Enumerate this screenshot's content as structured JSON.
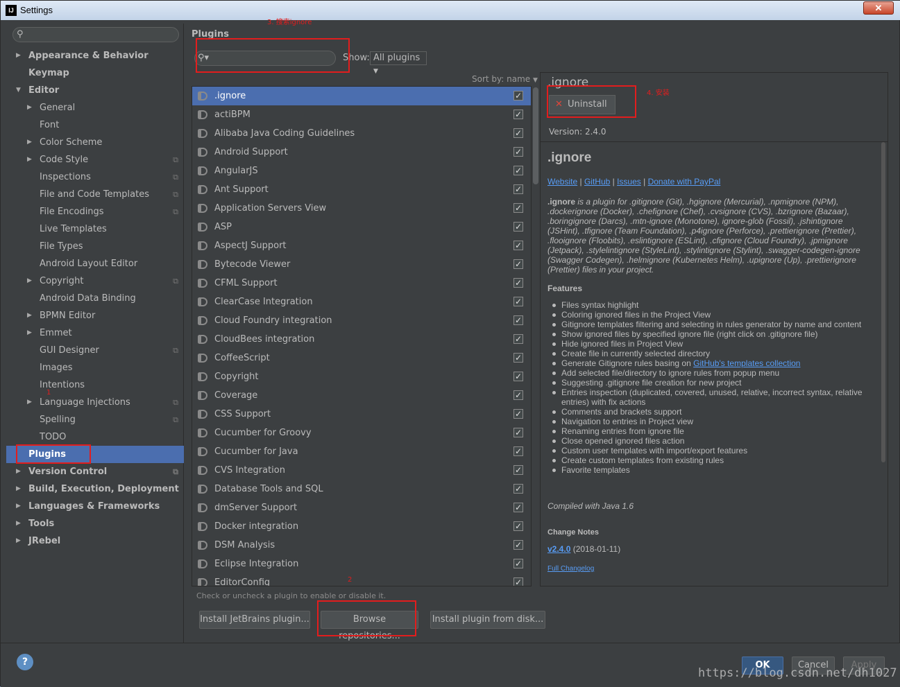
{
  "window": {
    "title": "Settings",
    "app_icon": "IJ",
    "close": "✕"
  },
  "sidebar": {
    "search_placeholder": "",
    "items": [
      {
        "label": "Appearance & Behavior"
      },
      {
        "label": "Keymap"
      },
      {
        "label": "Editor"
      },
      {
        "label": "General"
      },
      {
        "label": "Font"
      },
      {
        "label": "Color Scheme"
      },
      {
        "label": "Code Style"
      },
      {
        "label": "Inspections"
      },
      {
        "label": "File and Code Templates"
      },
      {
        "label": "File Encodings"
      },
      {
        "label": "Live Templates"
      },
      {
        "label": "File Types"
      },
      {
        "label": "Android Layout Editor"
      },
      {
        "label": "Copyright"
      },
      {
        "label": "Android Data Binding"
      },
      {
        "label": "BPMN Editor"
      },
      {
        "label": "Emmet"
      },
      {
        "label": "GUI Designer"
      },
      {
        "label": "Images"
      },
      {
        "label": "Intentions"
      },
      {
        "label": "Language Injections"
      },
      {
        "label": "Spelling"
      },
      {
        "label": "TODO"
      },
      {
        "label": "Plugins"
      },
      {
        "label": "Version Control"
      },
      {
        "label": "Build, Execution, Deployment"
      },
      {
        "label": "Languages & Frameworks"
      },
      {
        "label": "Tools"
      },
      {
        "label": "JRebel"
      }
    ]
  },
  "plugins": {
    "title": "Plugins",
    "search_value": "",
    "show_label": "Show:",
    "show_value": "All plugins",
    "sort_label": "Sort by: name",
    "list": [
      ".ignore",
      "actiBPM",
      "Alibaba Java Coding Guidelines",
      "Android Support",
      "AngularJS",
      "Ant Support",
      "Application Servers View",
      "ASP",
      "AspectJ Support",
      "Bytecode Viewer",
      "CFML Support",
      "ClearCase Integration",
      "Cloud Foundry integration",
      "CloudBees integration",
      "CoffeeScript",
      "Copyright",
      "Coverage",
      "CSS Support",
      "Cucumber for Groovy",
      "Cucumber for Java",
      "CVS Integration",
      "Database Tools and SQL",
      "dmServer Support",
      "Docker integration",
      "DSM Analysis",
      "Eclipse Integration",
      "EditorConfig"
    ],
    "checkmark": "✓",
    "hint": "Check or uncheck a plugin to enable or disable it.",
    "buttons": {
      "install_jetbrains": "Install JetBrains plugin...",
      "browse": "Browse repositories...",
      "install_disk": "Install plugin from disk..."
    }
  },
  "detail": {
    "name": ".ignore",
    "uninstall": "Uninstall",
    "version": "Version: 2.4.0",
    "heading": ".ignore",
    "links": [
      "Website",
      "GitHub",
      "Issues",
      "Donate with PayPal"
    ],
    "intro_name": ".ignore",
    "intro_text": " is a plugin for .gitignore (Git), .hgignore (Mercurial), .npmignore (NPM), .dockerignore (Docker), .chefignore (Chef), .cvsignore (CVS), .bzrignore (Bazaar), .boringignore (Darcs), .mtn-ignore (Monotone), ignore-glob (Fossil), .jshintignore (JSHint), .tfignore (Team Foundation), .p4ignore (Perforce), .prettierignore (Prettier), .flooignore (Floobits), .eslintignore (ESLint), .cfignore (Cloud Foundry), .jpmignore (Jetpack), .stylelintignore (StyleLint), .stylintignore (Stylint), .swagger-codegen-ignore (Swagger Codegen), .helmignore (Kubernetes Helm), .upignore (Up), .prettierignore (Prettier) files in your project.",
    "features_title": "Features",
    "features": [
      "Files syntax highlight",
      "Coloring ignored files in the Project View",
      "Gitignore templates filtering and selecting in rules generator by name and content",
      "Show ignored files by specified ignore file (right click on .gitignore file)",
      "Hide ignored files in Project View",
      "Create file in currently selected directory",
      "Generate Gitignore rules basing on ",
      "Add selected file/directory to ignore rules from popup menu",
      "Suggesting .gitignore file creation for new project",
      "Entries inspection (duplicated, covered, unused, relative, incorrect syntax, relative entries) with fix actions",
      "Comments and brackets support",
      "Navigation to entries in Project view",
      "Renaming entries from ignore file",
      "Close opened ignored files action",
      "Custom user templates with import/export features",
      "Create custom templates from existing rules",
      "Favorite templates"
    ],
    "features_link": "GitHub's templates collection",
    "compiled": "Compiled with Java 1.6",
    "change_notes_title": "Change Notes",
    "change_version": "v2.4.0",
    "change_date": " (2018-01-11)",
    "full_changelog": "Full Changelog"
  },
  "footer": {
    "help": "?",
    "ok": "OK",
    "cancel": "Cancel",
    "apply": "Apply"
  },
  "annotations": {
    "n1": "1",
    "n2": "2",
    "n3": "3. 搜索ignore",
    "n4": "4. 安装"
  },
  "watermark": "https://blog.csdn.net/dh1027",
  "colors": {
    "selection": "#4b6eaf",
    "background": "#3c3f41",
    "link": "#589df6",
    "annotation": "#e31d1d"
  }
}
